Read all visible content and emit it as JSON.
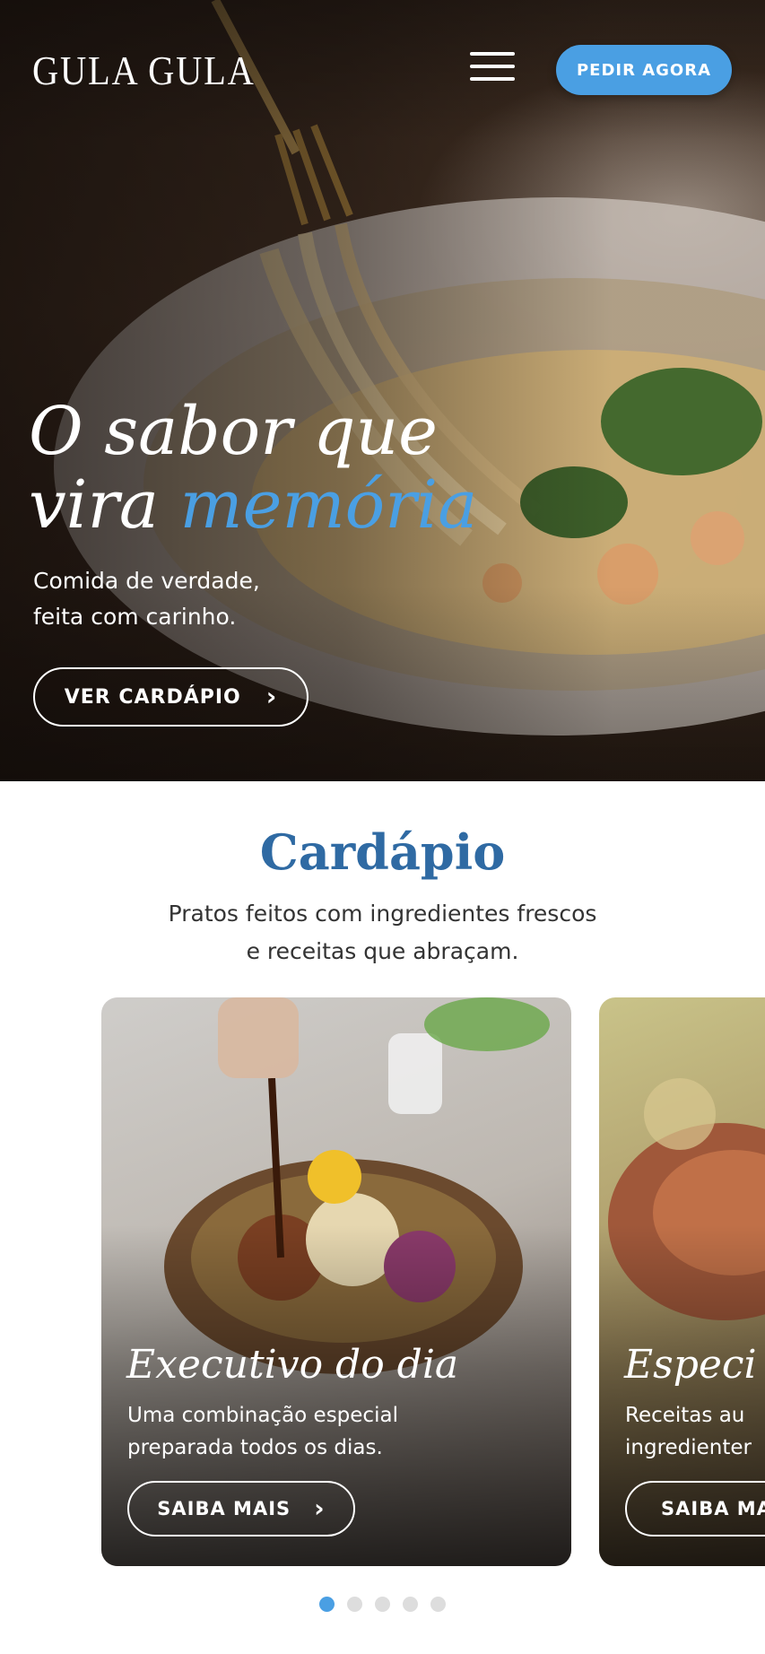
{
  "header": {
    "logo": "GULA GULA",
    "menu_icon": "hamburger-menu-icon",
    "order_button": "PEDIR AGORA"
  },
  "hero": {
    "title_line1": "O sabor que",
    "title_line2_plain": "vira ",
    "title_line2_accent": "memória",
    "subtitle_line1": "Comida de verdade,",
    "subtitle_line2": "feita com carinho.",
    "cta": "VER CARDÁPIO",
    "cta_icon": "chevron-right-icon"
  },
  "menu": {
    "title": "Cardápio",
    "subtitle_line1": "Pratos feitos com ingredientes frescos",
    "subtitle_line2": "e receitas que abraçam.",
    "cards": [
      {
        "title": "Executivo do dia",
        "desc_line1": "Uma combinação especial",
        "desc_line2": "preparada todos os dias.",
        "button": "SAIBA MAIS"
      },
      {
        "title": "Especi",
        "desc_line1": "Receitas au",
        "desc_line2": "ingredienter",
        "button": "SAIBA MA"
      }
    ],
    "pagination": {
      "total": 5,
      "active": 1
    }
  },
  "colors": {
    "accent": "#4a9fe3",
    "section_title": "#2f6aa3"
  }
}
